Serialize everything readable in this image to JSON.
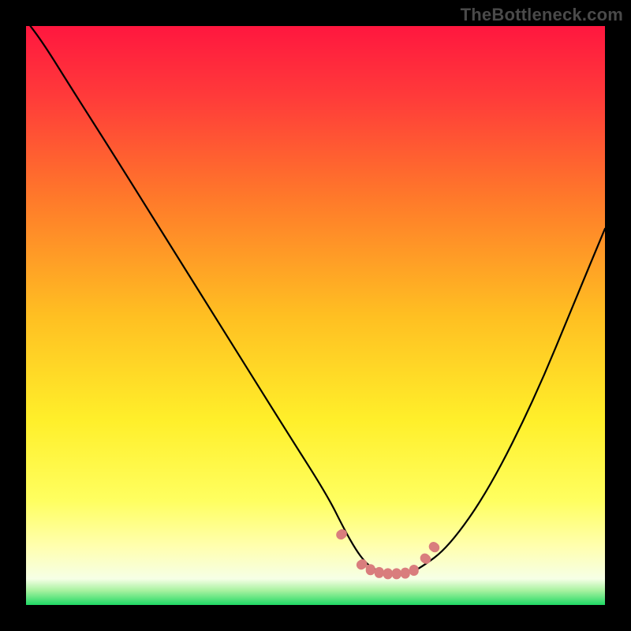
{
  "watermark": "TheBottleneck.com",
  "colors": {
    "bg_black": "#000000",
    "grad_top": "#ff173f",
    "grad_mid1": "#ff6a2a",
    "grad_mid2": "#ffd92a",
    "grad_low": "#ffff55",
    "grad_near_bottom": "#ffffc0",
    "grad_bottom": "#22e06a",
    "marker": "#d97d7d",
    "curve": "#000000"
  },
  "chart_data": {
    "type": "line",
    "title": "",
    "xlabel": "",
    "ylabel": "",
    "xlim": [
      0,
      100
    ],
    "ylim": [
      0,
      100
    ],
    "grid": false,
    "series": [
      {
        "name": "bottleneck-curve",
        "x": [
          0,
          3,
          8,
          15,
          25,
          35,
          45,
          52,
          55,
          57,
          58.5,
          60,
          62,
          64,
          66,
          68,
          73,
          80,
          88,
          95,
          100
        ],
        "y": [
          101,
          97,
          89,
          78,
          62,
          46,
          30,
          19,
          13,
          9.5,
          7.5,
          6.2,
          5.6,
          5.4,
          5.5,
          6.3,
          10,
          20,
          36,
          53,
          65
        ]
      },
      {
        "name": "marker-cluster",
        "x": [
          54.5,
          58,
          59.5,
          61,
          62.5,
          64,
          65.5,
          67,
          69,
          70.5
        ],
        "y": [
          12.2,
          7.0,
          6.1,
          5.6,
          5.4,
          5.4,
          5.5,
          6.0,
          8.0,
          10.0
        ]
      }
    ]
  }
}
